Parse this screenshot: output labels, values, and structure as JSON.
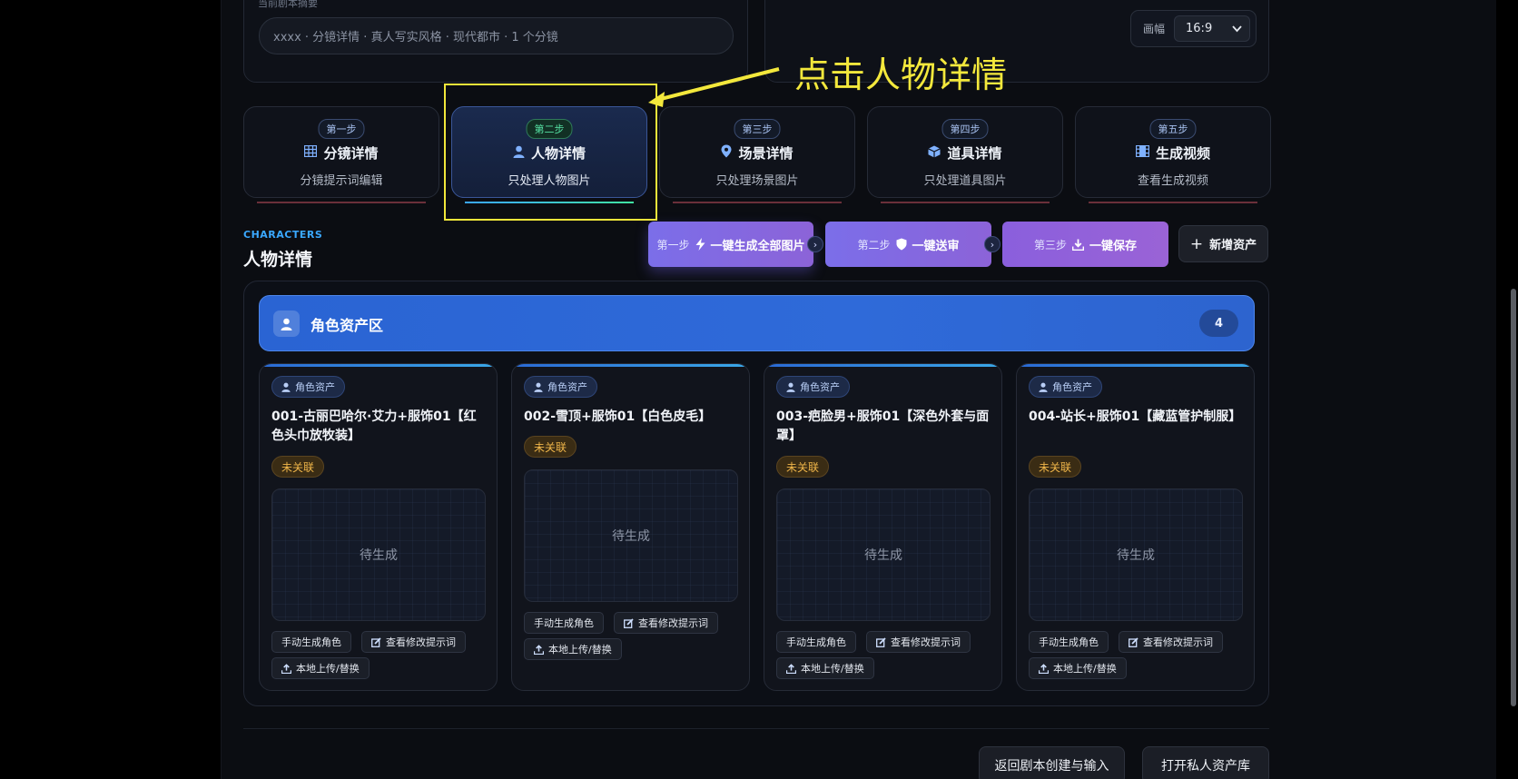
{
  "top": {
    "cut_label": "当前剧本摘要",
    "prompt_value": "xxxx · 分镜详情 · 真人写实风格 · 现代都市 · 1 个分镜",
    "ratio_label": "画幅",
    "ratio_value": "16:9"
  },
  "annotation": {
    "text": "点击人物详情",
    "color": "#f3e83c"
  },
  "steps": [
    {
      "badge": "第一步",
      "title": "分镜详情",
      "sub": "分镜提示词编辑",
      "icon": "grid-icon"
    },
    {
      "badge": "第二步",
      "title": "人物详情",
      "sub": "只处理人物图片",
      "icon": "person-icon",
      "active": true
    },
    {
      "badge": "第三步",
      "title": "场景详情",
      "sub": "只处理场景图片",
      "icon": "location-pin-icon"
    },
    {
      "badge": "第四步",
      "title": "道具详情",
      "sub": "只处理道具图片",
      "icon": "cube-icon"
    },
    {
      "badge": "第五步",
      "title": "生成视频",
      "sub": "查看生成视频",
      "icon": "film-icon"
    }
  ],
  "section": {
    "kicker": "CHARACTERS",
    "title": "人物详情"
  },
  "actions": [
    {
      "step": "第一步",
      "label": "一键生成全部图片",
      "icon": "lightning-icon"
    },
    {
      "step": "第二步",
      "label": "一键送审",
      "icon": "shield-icon"
    },
    {
      "step": "第三步",
      "label": "一键保存",
      "icon": "download-icon"
    }
  ],
  "add_asset": "新增资产",
  "asset_zone": {
    "title": "角色资产区",
    "count": "4"
  },
  "cards": [
    {
      "tag": "角色资产",
      "title": "001-古丽巴哈尔·艾力+服饰01【红色头巾放牧装】",
      "status": "未关联",
      "preview": "待生成",
      "btn_manual": "手动生成角色",
      "btn_prompt": "查看修改提示词",
      "btn_upload": "本地上传/替换"
    },
    {
      "tag": "角色资产",
      "title": "002-雪顶+服饰01【白色皮毛】",
      "status": "未关联",
      "preview": "待生成",
      "btn_manual": "手动生成角色",
      "btn_prompt": "查看修改提示词",
      "btn_upload": "本地上传/替换"
    },
    {
      "tag": "角色资产",
      "title": "003-疤脸男+服饰01【深色外套与面罩】",
      "status": "未关联",
      "preview": "待生成",
      "btn_manual": "手动生成角色",
      "btn_prompt": "查看修改提示词",
      "btn_upload": "本地上传/替换"
    },
    {
      "tag": "角色资产",
      "title": "004-站长+服饰01【藏蓝管护制服】",
      "status": "未关联",
      "preview": "待生成",
      "btn_manual": "手动生成角色",
      "btn_prompt": "查看修改提示词",
      "btn_upload": "本地上传/替换"
    }
  ],
  "footer": {
    "back": "返回剧本创建与输入",
    "library": "打开私人资产库"
  },
  "colors": {
    "accent_blue": "#2f6ad9",
    "status_orange": "#f0b64a",
    "active_green": "#40e3a1"
  }
}
